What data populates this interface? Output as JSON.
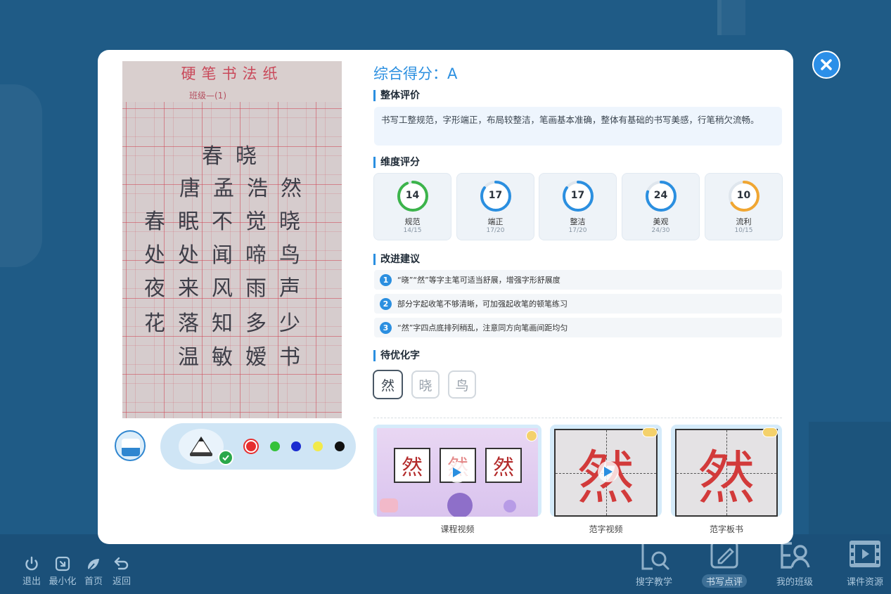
{
  "app": {
    "bottom_left": [
      {
        "label": "退出",
        "icon": "power-icon"
      },
      {
        "label": "最小化",
        "icon": "minimize-icon"
      },
      {
        "label": "首页",
        "icon": "home-icon"
      },
      {
        "label": "返回",
        "icon": "back-icon"
      }
    ],
    "bottom_nav": [
      {
        "label": "搜字教学",
        "icon": "search-character-icon"
      },
      {
        "label": "书写点评",
        "icon": "writing-review-icon",
        "active": true
      },
      {
        "label": "我的班级",
        "icon": "my-class-icon"
      },
      {
        "label": "课件资源",
        "icon": "courseware-icon"
      }
    ]
  },
  "photo": {
    "paper_title": "硬笔书法纸",
    "class_field": "班级—(1)",
    "rows": [
      [
        "",
        "春",
        "晓",
        ""
      ],
      [
        "唐",
        "孟",
        "浩",
        "然"
      ],
      [
        "春",
        "眠",
        "不",
        "觉",
        "晓"
      ],
      [
        "处",
        "处",
        "闻",
        "啼",
        "鸟"
      ],
      [
        "夜",
        "来",
        "风",
        "雨",
        "声"
      ],
      [
        "花",
        "落",
        "知",
        "多",
        "少"
      ],
      [
        "",
        "温",
        "敏",
        "嫒",
        "书"
      ]
    ]
  },
  "tools": {
    "colors": [
      "#e62e2e",
      "#34c23a",
      "#1a2bd0",
      "#f2ea4a",
      "#111111"
    ]
  },
  "result": {
    "score_label": "综合得分：A",
    "overall_title": "整体评价",
    "overall_text": "书写工整规范，字形端正，布局较整洁，笔画基本准确，整体有基础的书写美感，行笔稍欠流畅。",
    "dimension_title": "维度评分",
    "dimensions": [
      {
        "name": "规范",
        "score": 14,
        "max": 15,
        "sub": "14/15",
        "color": "#3cb44b"
      },
      {
        "name": "端正",
        "score": 17,
        "max": 20,
        "sub": "17/20",
        "color": "#2b8fe0"
      },
      {
        "name": "整洁",
        "score": 17,
        "max": 20,
        "sub": "17/20",
        "color": "#2b8fe0"
      },
      {
        "name": "美观",
        "score": 24,
        "max": 30,
        "sub": "24/30",
        "color": "#2b8fe0"
      },
      {
        "name": "流利",
        "score": 10,
        "max": 15,
        "sub": "10/15",
        "color": "#f0a632"
      }
    ],
    "suggest_title": "改进建议",
    "suggestions": [
      {
        "num": "1",
        "text": "“晓”“然”等字主笔可适当舒展，增强字形舒展度"
      },
      {
        "num": "2",
        "text": "部分字起收笔不够清晰，可加强起收笔的顿笔练习"
      },
      {
        "num": "3",
        "text": "“然”字四点底排列稍乱，注意同方向笔画间距均匀"
      }
    ],
    "optimize_title": "待优化字",
    "optimize_chars": [
      "然",
      "晓",
      "鸟"
    ],
    "resources": [
      {
        "label": "课程视频",
        "chars": [
          "然",
          "然",
          "然"
        ]
      },
      {
        "label": "范字视频",
        "char": "然"
      },
      {
        "label": "范字板书",
        "char": "然"
      }
    ]
  }
}
